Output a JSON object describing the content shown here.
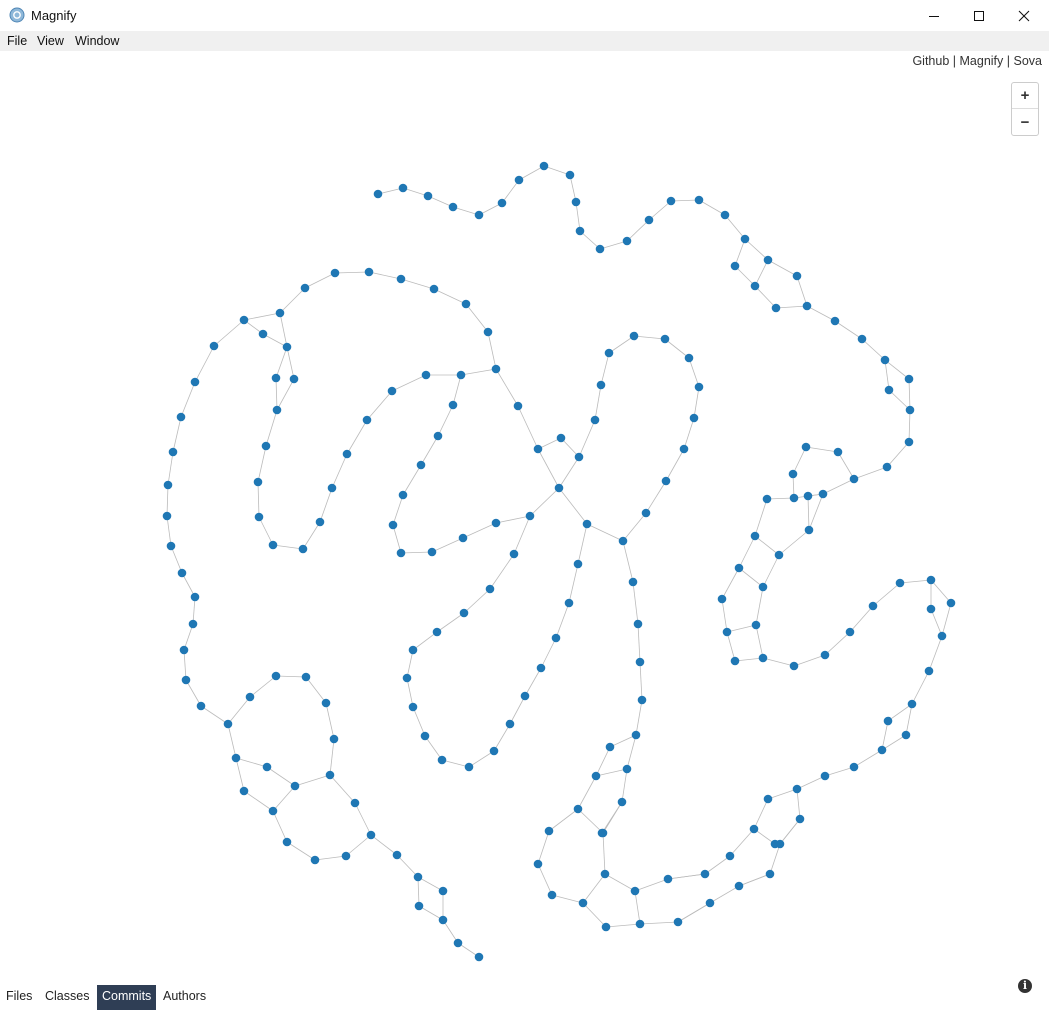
{
  "window": {
    "title": "Magnify"
  },
  "menu": {
    "items": [
      "File",
      "View",
      "Window"
    ]
  },
  "links": {
    "github": "Github",
    "magnify": "Magnify",
    "sova": "Sova",
    "sep": "|"
  },
  "zoom": {
    "in": "+",
    "out": "−"
  },
  "tabs": {
    "files": "Files",
    "classes": "Classes",
    "commits": "Commits",
    "authors": "Authors",
    "active": "commits"
  },
  "colors": {
    "node": "#1f77b4",
    "link": "#bbbbbb",
    "active_tab_bg": "#2f3e55"
  },
  "icons": {
    "app": "magnify-app-icon",
    "info": "info-icon"
  }
}
